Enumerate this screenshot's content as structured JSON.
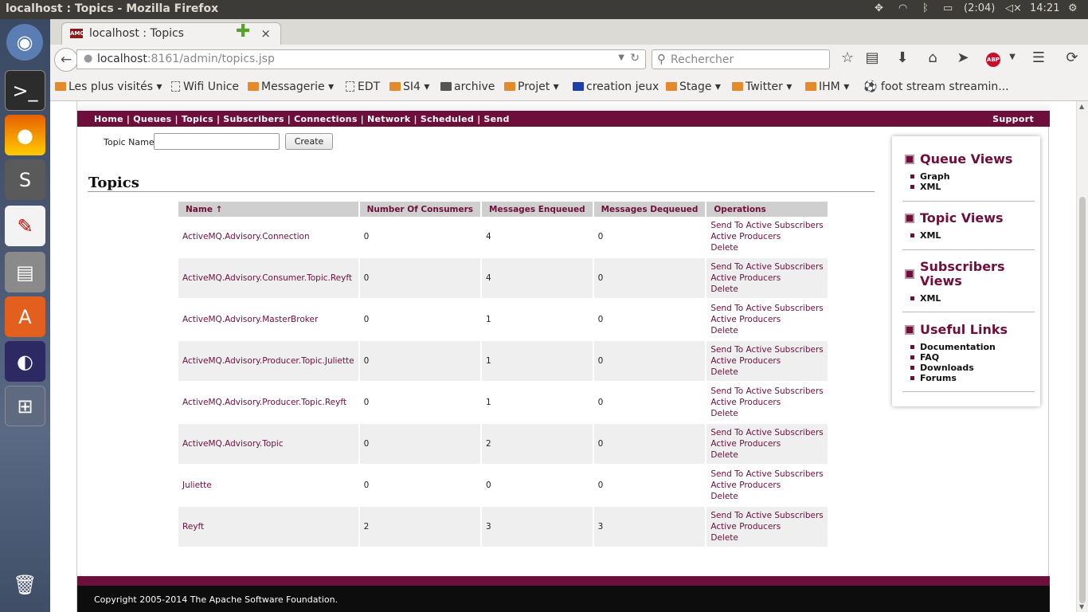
{
  "os": {
    "window_title": "localhost : Topics - Mozilla Firefox",
    "battery": "(2:04)",
    "clock": "14:21"
  },
  "browser": {
    "tab_title": "localhost : Topics",
    "url_host": "localhost",
    "url_path": ":8161/admin/topics.jsp",
    "search_placeholder": "Rechercher",
    "bookmarks": [
      "Les plus visités",
      "Wifi Unice",
      "Messagerie",
      "EDT",
      "SI4",
      "archive",
      "Projet",
      "creation jeux",
      "Stage",
      "Twitter",
      "IHM",
      "foot stream streamin..."
    ]
  },
  "nav": {
    "items": [
      "Home",
      "Queues",
      "Topics",
      "Subscribers",
      "Connections",
      "Network",
      "Scheduled",
      "Send"
    ],
    "support": "Support"
  },
  "form": {
    "topic_name_label": "Topic Name",
    "topic_name_value": "",
    "create_label": "Create"
  },
  "page": {
    "title": "Topics"
  },
  "table": {
    "headers": [
      "Name ↑",
      "Number Of Consumers",
      "Messages Enqueued",
      "Messages Dequeued",
      "Operations"
    ],
    "operations": [
      "Send To Active Subscribers",
      "Active Producers",
      "Delete"
    ],
    "rows": [
      {
        "name": "ActiveMQ.Advisory.Connection",
        "consumers": "0",
        "enqueued": "4",
        "dequeued": "0"
      },
      {
        "name": "ActiveMQ.Advisory.Consumer.Topic.Reyft",
        "consumers": "0",
        "enqueued": "4",
        "dequeued": "0"
      },
      {
        "name": "ActiveMQ.Advisory.MasterBroker",
        "consumers": "0",
        "enqueued": "1",
        "dequeued": "0"
      },
      {
        "name": "ActiveMQ.Advisory.Producer.Topic.Juliette",
        "consumers": "0",
        "enqueued": "1",
        "dequeued": "0"
      },
      {
        "name": "ActiveMQ.Advisory.Producer.Topic.Reyft",
        "consumers": "0",
        "enqueued": "1",
        "dequeued": "0"
      },
      {
        "name": "ActiveMQ.Advisory.Topic",
        "consumers": "0",
        "enqueued": "2",
        "dequeued": "0"
      },
      {
        "name": "Juliette",
        "consumers": "0",
        "enqueued": "0",
        "dequeued": "0"
      },
      {
        "name": "Reyft",
        "consumers": "2",
        "enqueued": "3",
        "dequeued": "3"
      }
    ]
  },
  "sidebar": {
    "sections": [
      {
        "title": "Queue Views",
        "links": [
          "Graph",
          "XML"
        ]
      },
      {
        "title": "Topic Views",
        "links": [
          "XML"
        ]
      },
      {
        "title": "Subscribers Views",
        "links": [
          "XML"
        ]
      },
      {
        "title": "Useful Links",
        "links": [
          "Documentation",
          "FAQ",
          "Downloads",
          "Forums"
        ]
      }
    ]
  },
  "footer": {
    "copyright": "Copyright 2005-2014 The Apache Software Foundation."
  },
  "colors": {
    "accent": "#6e0f3b",
    "header_bg": "#cfcfcf",
    "footer_bg": "#0d0d0d"
  }
}
